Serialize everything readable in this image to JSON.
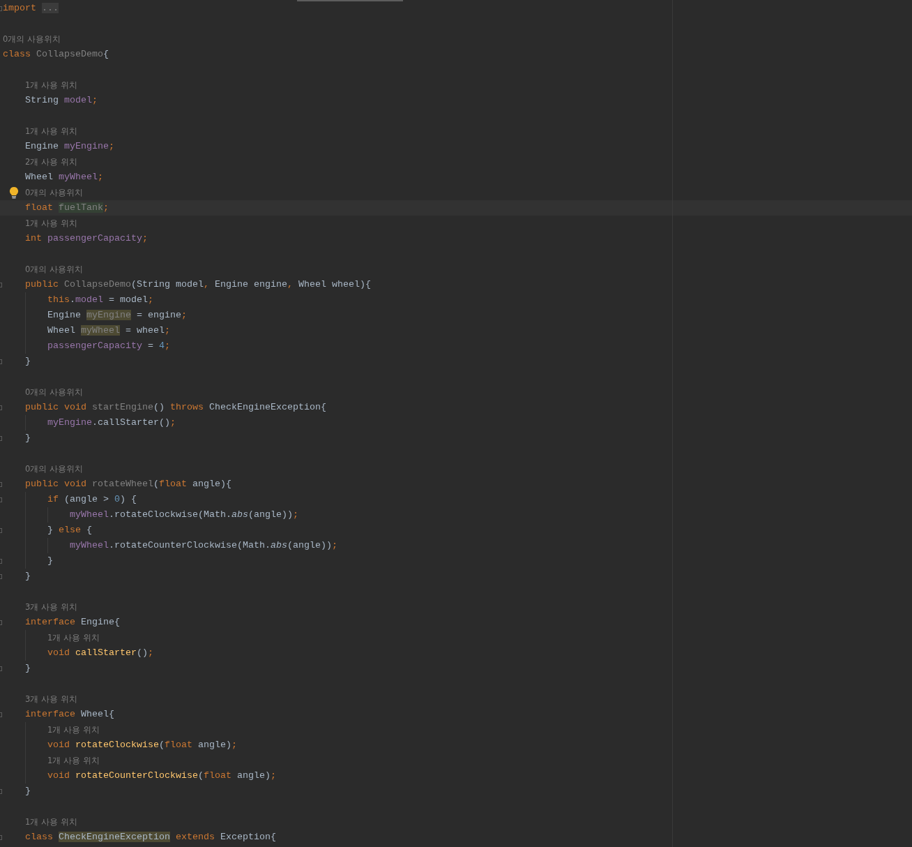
{
  "editor": {
    "lines": [
      {
        "kind": "code",
        "fold": true,
        "tokens": [
          {
            "text": "import ",
            "kind": "keyword"
          },
          {
            "text": "...",
            "kind": "folded"
          }
        ]
      },
      {
        "kind": "blank"
      },
      {
        "kind": "hint",
        "text": "0개의 사용위치"
      },
      {
        "kind": "code",
        "tokens": [
          {
            "text": "class ",
            "kind": "keyword"
          },
          {
            "text": "CollapseDemo",
            "kind": "unused"
          },
          {
            "text": "{",
            "kind": "plain"
          }
        ],
        "children": [
          {
            "kind": "blank"
          },
          {
            "kind": "hint",
            "text": "1개 사용 위치"
          },
          {
            "kind": "code",
            "tokens": [
              {
                "text": "String ",
                "kind": "plain"
              },
              {
                "text": "model",
                "kind": "field"
              },
              {
                "text": ";",
                "kind": "keyword"
              }
            ]
          },
          {
            "kind": "blank"
          },
          {
            "kind": "hint",
            "text": "1개 사용 위치"
          },
          {
            "kind": "code",
            "tokens": [
              {
                "text": "Engine ",
                "kind": "plain"
              },
              {
                "text": "myEngine",
                "kind": "field"
              },
              {
                "text": ";",
                "kind": "keyword"
              }
            ]
          },
          {
            "kind": "hint",
            "text": "2개 사용 위치"
          },
          {
            "kind": "code",
            "tokens": [
              {
                "text": "Wheel ",
                "kind": "plain"
              },
              {
                "text": "myWheel",
                "kind": "field"
              },
              {
                "text": ";",
                "kind": "keyword"
              }
            ]
          },
          {
            "kind": "hint",
            "text": "0개의 사용위치",
            "intention_bulb": true
          },
          {
            "kind": "code",
            "current": true,
            "tokens": [
              {
                "text": "float ",
                "kind": "keyword"
              },
              {
                "text": "fuelTank",
                "kind": "unused",
                "unused_highlight": true
              },
              {
                "text": ";",
                "kind": "keyword"
              }
            ]
          },
          {
            "kind": "hint",
            "text": "1개 사용 위치"
          },
          {
            "kind": "code",
            "tokens": [
              {
                "text": "int ",
                "kind": "keyword"
              },
              {
                "text": "passengerCapacity",
                "kind": "field"
              },
              {
                "text": ";",
                "kind": "keyword"
              }
            ]
          },
          {
            "kind": "blank"
          },
          {
            "kind": "hint",
            "text": "0개의 사용위치"
          },
          {
            "kind": "code",
            "fold": true,
            "tokens": [
              {
                "text": "public ",
                "kind": "keyword"
              },
              {
                "text": "CollapseDemo",
                "kind": "unused"
              },
              {
                "text": "(String model",
                "kind": "plain"
              },
              {
                "text": ",",
                "kind": "keyword"
              },
              {
                "text": " Engine engine",
                "kind": "plain"
              },
              {
                "text": ",",
                "kind": "keyword"
              },
              {
                "text": " Wheel wheel){",
                "kind": "plain"
              }
            ],
            "children": [
              {
                "kind": "code",
                "tokens": [
                  {
                    "text": "this",
                    "kind": "keyword"
                  },
                  {
                    "text": ".",
                    "kind": "plain"
                  },
                  {
                    "text": "model",
                    "kind": "field"
                  },
                  {
                    "text": " = model",
                    "kind": "plain"
                  },
                  {
                    "text": ";",
                    "kind": "keyword"
                  }
                ]
              },
              {
                "kind": "code",
                "tokens": [
                  {
                    "text": "Engine ",
                    "kind": "plain"
                  },
                  {
                    "text": "myEngine",
                    "kind": "unused",
                    "usage_highlight": true
                  },
                  {
                    "text": " = engine",
                    "kind": "plain"
                  },
                  {
                    "text": ";",
                    "kind": "keyword"
                  }
                ]
              },
              {
                "kind": "code",
                "tokens": [
                  {
                    "text": "Wheel ",
                    "kind": "plain"
                  },
                  {
                    "text": "myWheel",
                    "kind": "unused",
                    "usage_highlight": true
                  },
                  {
                    "text": " = wheel",
                    "kind": "plain"
                  },
                  {
                    "text": ";",
                    "kind": "keyword"
                  }
                ]
              },
              {
                "kind": "code",
                "tokens": [
                  {
                    "text": "passengerCapacity",
                    "kind": "field"
                  },
                  {
                    "text": " = ",
                    "kind": "plain"
                  },
                  {
                    "text": "4",
                    "kind": "number"
                  },
                  {
                    "text": ";",
                    "kind": "keyword"
                  }
                ]
              }
            ]
          },
          {
            "kind": "code",
            "fold": true,
            "tokens": [
              {
                "text": "}",
                "kind": "plain"
              }
            ]
          },
          {
            "kind": "blank"
          },
          {
            "kind": "hint",
            "text": "0개의 사용위치"
          },
          {
            "kind": "code",
            "fold": true,
            "tokens": [
              {
                "text": "public void ",
                "kind": "keyword"
              },
              {
                "text": "startEngine",
                "kind": "unused"
              },
              {
                "text": "() ",
                "kind": "plain"
              },
              {
                "text": "throws ",
                "kind": "keyword"
              },
              {
                "text": "CheckEngineException{",
                "kind": "plain"
              }
            ],
            "children": [
              {
                "kind": "code",
                "tokens": [
                  {
                    "text": "myEngine",
                    "kind": "field"
                  },
                  {
                    "text": ".callStarter()",
                    "kind": "plain"
                  },
                  {
                    "text": ";",
                    "kind": "keyword"
                  }
                ]
              }
            ]
          },
          {
            "kind": "code",
            "fold": true,
            "tokens": [
              {
                "text": "}",
                "kind": "plain"
              }
            ]
          },
          {
            "kind": "blank"
          },
          {
            "kind": "hint",
            "text": "0개의 사용위치"
          },
          {
            "kind": "code",
            "fold": true,
            "tokens": [
              {
                "text": "public void ",
                "kind": "keyword"
              },
              {
                "text": "rotateWheel",
                "kind": "unused"
              },
              {
                "text": "(",
                "kind": "plain"
              },
              {
                "text": "float",
                "kind": "keyword"
              },
              {
                "text": " angle){",
                "kind": "plain"
              }
            ],
            "children": [
              {
                "kind": "code",
                "fold": true,
                "tokens": [
                  {
                    "text": "if ",
                    "kind": "keyword"
                  },
                  {
                    "text": "(angle > ",
                    "kind": "plain"
                  },
                  {
                    "text": "0",
                    "kind": "number"
                  },
                  {
                    "text": ") {",
                    "kind": "plain"
                  }
                ],
                "children": [
                  {
                    "kind": "code",
                    "tokens": [
                      {
                        "text": "myWheel",
                        "kind": "field"
                      },
                      {
                        "text": ".rotateClockwise(Math.",
                        "kind": "plain"
                      },
                      {
                        "text": "abs",
                        "kind": "static"
                      },
                      {
                        "text": "(angle))",
                        "kind": "plain"
                      },
                      {
                        "text": ";",
                        "kind": "keyword"
                      }
                    ]
                  }
                ]
              },
              {
                "kind": "code",
                "fold": true,
                "tokens": [
                  {
                    "text": "} ",
                    "kind": "plain"
                  },
                  {
                    "text": "else ",
                    "kind": "keyword"
                  },
                  {
                    "text": "{",
                    "kind": "plain"
                  }
                ],
                "children": [
                  {
                    "kind": "code",
                    "tokens": [
                      {
                        "text": "myWheel",
                        "kind": "field"
                      },
                      {
                        "text": ".rotateCounterClockwise(Math.",
                        "kind": "plain"
                      },
                      {
                        "text": "abs",
                        "kind": "static"
                      },
                      {
                        "text": "(angle))",
                        "kind": "plain"
                      },
                      {
                        "text": ";",
                        "kind": "keyword"
                      }
                    ]
                  }
                ]
              },
              {
                "kind": "code",
                "fold": true,
                "tokens": [
                  {
                    "text": "}",
                    "kind": "plain"
                  }
                ]
              }
            ]
          },
          {
            "kind": "code",
            "fold": true,
            "tokens": [
              {
                "text": "}",
                "kind": "plain"
              }
            ]
          },
          {
            "kind": "blank"
          },
          {
            "kind": "hint",
            "text": "3개 사용 위치"
          },
          {
            "kind": "code",
            "fold": true,
            "tokens": [
              {
                "text": "interface ",
                "kind": "keyword"
              },
              {
                "text": "Engine{",
                "kind": "plain"
              }
            ],
            "children": [
              {
                "kind": "hint",
                "text": "1개 사용 위치"
              },
              {
                "kind": "code",
                "tokens": [
                  {
                    "text": "void ",
                    "kind": "keyword"
                  },
                  {
                    "text": "callStarter",
                    "kind": "declaration"
                  },
                  {
                    "text": "()",
                    "kind": "plain"
                  },
                  {
                    "text": ";",
                    "kind": "keyword"
                  }
                ]
              }
            ]
          },
          {
            "kind": "code",
            "fold": true,
            "tokens": [
              {
                "text": "}",
                "kind": "plain"
              }
            ]
          },
          {
            "kind": "blank"
          },
          {
            "kind": "hint",
            "text": "3개 사용 위치"
          },
          {
            "kind": "code",
            "fold": true,
            "tokens": [
              {
                "text": "interface ",
                "kind": "keyword"
              },
              {
                "text": "Wheel{",
                "kind": "plain"
              }
            ],
            "children": [
              {
                "kind": "hint",
                "text": "1개 사용 위치"
              },
              {
                "kind": "code",
                "tokens": [
                  {
                    "text": "void ",
                    "kind": "keyword"
                  },
                  {
                    "text": "rotateClockwise",
                    "kind": "declaration"
                  },
                  {
                    "text": "(",
                    "kind": "plain"
                  },
                  {
                    "text": "float",
                    "kind": "keyword"
                  },
                  {
                    "text": " angle)",
                    "kind": "plain"
                  },
                  {
                    "text": ";",
                    "kind": "keyword"
                  }
                ]
              },
              {
                "kind": "hint",
                "text": "1개 사용 위치"
              },
              {
                "kind": "code",
                "tokens": [
                  {
                    "text": "void ",
                    "kind": "keyword"
                  },
                  {
                    "text": "rotateCounterClockwise",
                    "kind": "declaration"
                  },
                  {
                    "text": "(",
                    "kind": "plain"
                  },
                  {
                    "text": "float",
                    "kind": "keyword"
                  },
                  {
                    "text": " angle)",
                    "kind": "plain"
                  },
                  {
                    "text": ";",
                    "kind": "keyword"
                  }
                ]
              }
            ]
          },
          {
            "kind": "code",
            "fold": true,
            "tokens": [
              {
                "text": "}",
                "kind": "plain"
              }
            ]
          },
          {
            "kind": "blank"
          },
          {
            "kind": "hint",
            "text": "1개 사용 위치"
          },
          {
            "kind": "code",
            "fold": true,
            "tokens": [
              {
                "text": "class ",
                "kind": "keyword"
              },
              {
                "text": "CheckEngineException",
                "kind": "plain",
                "usage_highlight": true
              },
              {
                "text": " extends ",
                "kind": "keyword"
              },
              {
                "text": "Exception{",
                "kind": "plain"
              }
            ]
          }
        ]
      }
    ]
  }
}
